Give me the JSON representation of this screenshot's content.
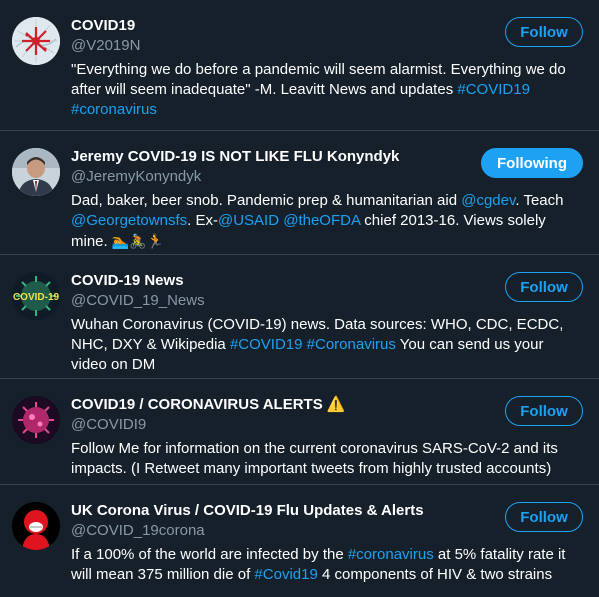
{
  "accounts": [
    {
      "name": "COVID19",
      "handle": "@V2019N",
      "button": "Follow",
      "bio": [
        {
          "t": "\"Everything we do before a pandemic will seem alarmist. Everything we do after will seem inadequate\" -M. Leavitt News and updates "
        },
        {
          "t": "#COVID19",
          "link": true
        },
        {
          "t": " "
        },
        {
          "t": "#coronavirus",
          "link": true
        }
      ]
    },
    {
      "name": "Jeremy COVID-19 IS NOT LIKE FLU Konyndyk",
      "handle": "@JeremyKonyndyk",
      "button": "Following",
      "bio": [
        {
          "t": "Dad, baker, beer snob. Pandemic prep & humanitarian aid "
        },
        {
          "t": "@cgdev",
          "link": true
        },
        {
          "t": ". Teach "
        },
        {
          "t": "@Georgetownsfs",
          "link": true
        },
        {
          "t": ". Ex-"
        },
        {
          "t": "@USAID",
          "link": true
        },
        {
          "t": " "
        },
        {
          "t": "@theOFDA",
          "link": true
        },
        {
          "t": " chief 2013-16. Views solely mine. "
        },
        {
          "t": "🏊🚴🏃",
          "emoji": true
        }
      ]
    },
    {
      "name": "COVID-19 News",
      "handle": "@COVID_19_News",
      "button": "Follow",
      "bio": [
        {
          "t": "Wuhan Coronavirus (COVID-19) news. Data sources: WHO, CDC, ECDC, NHC, DXY & Wikipedia "
        },
        {
          "t": "#COVID19",
          "link": true
        },
        {
          "t": " "
        },
        {
          "t": "#Coronavirus",
          "link": true
        },
        {
          "t": " You can send us your video on DM"
        }
      ]
    },
    {
      "name": "COVID19 / CORONAVIRUS ALERTS ⚠️",
      "handle": "@COVIDI9",
      "button": "Follow",
      "bio": [
        {
          "t": "Follow Me for information on the current coronavirus SARS-CoV-2 and its impacts. (I Retweet many important tweets from highly trusted accounts)"
        }
      ]
    },
    {
      "name": "UK Corona Virus / COVID-19 Flu Updates & Alerts",
      "handle": "@COVID_19corona",
      "button": "Follow",
      "bio": [
        {
          "t": "If a 100% of the world are infected by the "
        },
        {
          "t": "#coronavirus",
          "link": true
        },
        {
          "t": " at 5% fatality rate it will mean 375 million die of "
        },
        {
          "t": "#Covid19",
          "link": true
        },
        {
          "t": " 4 components of HIV & two strains"
        }
      ]
    }
  ],
  "avatar_labels": {
    "covid_news": "COVID-19"
  },
  "colors": {
    "background": "#15202b",
    "accent": "#1da1f2",
    "secondary_text": "#8899a6",
    "divider": "#38444d"
  }
}
